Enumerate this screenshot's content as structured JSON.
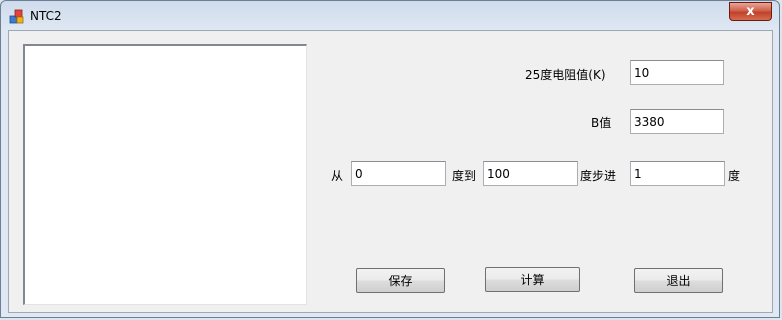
{
  "window": {
    "title": "NTC2",
    "close_glyph": "x"
  },
  "params": {
    "r25_label": "25度电阻值(K)",
    "r25_value": "10",
    "b_label": "B值",
    "b_value": "3380"
  },
  "range": {
    "from_label": "从",
    "from_value": "0",
    "to_label": "度到",
    "to_value": "100",
    "step_label": "度步进",
    "step_value": "1",
    "unit_label": "度"
  },
  "buttons": {
    "save": "保存",
    "calc": "计算",
    "exit": "退出"
  },
  "icons": {
    "app": "app-icon",
    "close": "close-icon"
  },
  "colors": {
    "close_button": "#c2402a",
    "title_bar": "#cfdced"
  }
}
